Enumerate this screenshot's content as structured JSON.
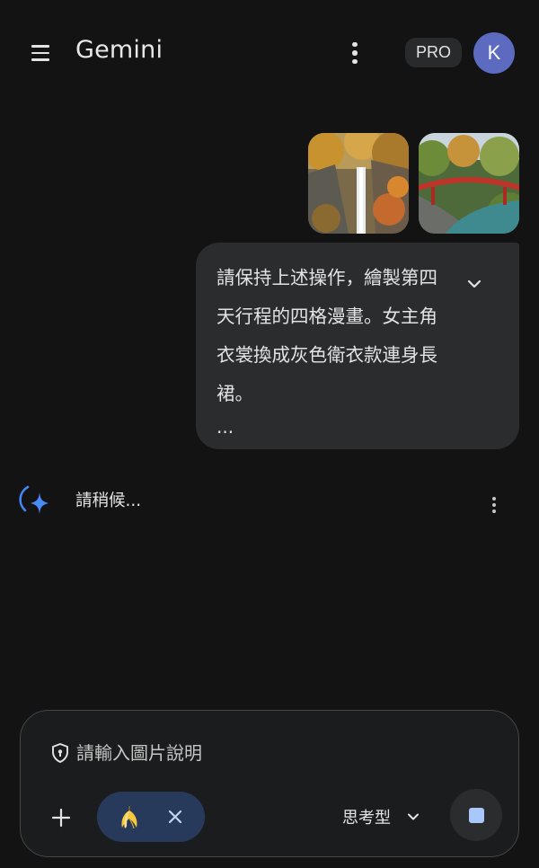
{
  "header": {
    "menu_icon": "hamburger-menu-icon",
    "title": "Gemini",
    "more_icon": "more-vertical-icon",
    "plan_badge": "PRO",
    "avatar_initial": "K",
    "avatar_color": "#5c6bc0"
  },
  "conversation": {
    "user_message": {
      "attachments": [
        {
          "icon": "waterfall-photo-thumbnail"
        },
        {
          "icon": "red-bridge-photo-thumbnail"
        }
      ],
      "text": "請保持上述操作，繪製第四天行程的四格漫畫。女主角衣裳換成灰色衛衣款連身長裙。",
      "ellipsis": "...",
      "expand_icon": "chevron-down-icon"
    },
    "model_response": {
      "icon": "gemini-sparkle-loading-icon",
      "status_text": "請稍候...",
      "more_icon": "more-vertical-icon"
    }
  },
  "composer": {
    "placeholder": "請輸入圖片說明",
    "value": "",
    "shield_icon": "shield-icon",
    "add_icon": "plus-icon",
    "tool_chip": {
      "emoji": "🍌",
      "close_icon": "close-icon"
    },
    "mode": {
      "label": "思考型",
      "chevron_icon": "chevron-down-icon"
    },
    "stop_icon": "stop-icon"
  },
  "colors": {
    "background": "#131314",
    "bubble": "#2b2c2e",
    "chip": "#283a5c",
    "accent": "#a8c7fa",
    "sparkle": "#4285f4"
  }
}
